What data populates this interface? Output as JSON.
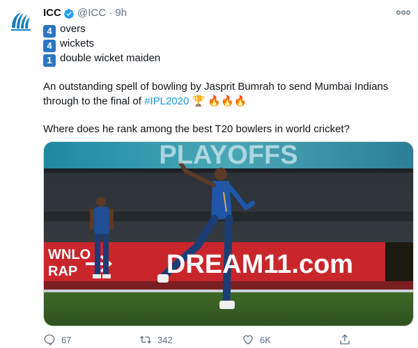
{
  "tweet": {
    "author_name": "ICC",
    "handle": "@ICC",
    "separator": "·",
    "time": "9h",
    "lines": [
      {
        "badge": "4",
        "text": "overs"
      },
      {
        "badge": "4",
        "text": "wickets"
      },
      {
        "badge": "1",
        "text": "double wicket maiden"
      }
    ],
    "para1_part1": "An outstanding spell of bowling by Jasprit Bumrah to send Mumbai Indians through to the final of ",
    "hashtag": "#IPL2020",
    "emojis": "🏆 🔥🔥🔥",
    "para2": "Where does he rank among the best T20 bowlers in world cricket?"
  },
  "media": {
    "banner_top": "PLAYOFFS",
    "banner_left": "WNLO\nRAP",
    "sponsor": "DREAM11.com"
  },
  "actions": {
    "replies": "67",
    "retweets": "342",
    "likes": "6K"
  }
}
